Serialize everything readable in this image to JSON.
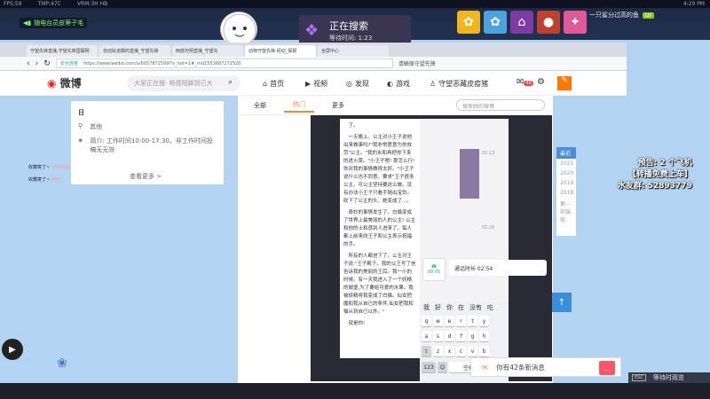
{
  "sysbar": [
    "FPS:59",
    "TMP:47C",
    "VRM:3H HB"
  ],
  "sysbar_time": "4:29 PM",
  "stream": {
    "connection": "随电台员皮蒂子毛",
    "search_title": "正在搜索",
    "wait_label": "等待时间: 1:23",
    "user_name": "一只鲨分过高的鱼",
    "user_level": "LV"
  },
  "browser": {
    "tabs": [
      "守望先锋直播,守望先锋国服网",
      "自动轨道脚的直播_守望先锋",
      "西部光明直播_守望先",
      "动物守望先锋-经动_探报",
      "全屏中心"
    ],
    "url": "https://www.weibo.com/u/6057872599?is_hot=1#_rnd1553687272520",
    "security_label": "安全连接",
    "extension_label": "请确保守望先锋"
  },
  "weibo": {
    "logo": "微博",
    "search_placeholder": "大家正在搜: 杨德阳脚到已大",
    "nav": [
      "首页",
      "视频",
      "发现",
      "游戏",
      "守望恶藏皮疫猪"
    ],
    "mail_badge": "40"
  },
  "card": {
    "title": "日",
    "other": "其他",
    "hours": "简介: 工作时间10:00-17:30。非工作时间投稿无无效",
    "more": "查看更多 >"
  },
  "feed": {
    "tabs": [
      "全部",
      "热门",
      "更多"
    ],
    "search_placeholder": "搜索她的微博",
    "novel_paragraphs": [
      "了。",
      "一天晚上。公主对小王子说他出来做事吗?\"我非常愿意为你效劳\"公主。\"我的永和再把你下来的进火菜。\"小王子嗯! 那怎么行! 你对我的事情做得太好。\"小王子说什么也不同意。要求\"王子很多公主。可公主坚持要这么做。没有办法小王子只看手随出宝剑。砍下了公主的头、她变成了...。",
      "奇妙的事情发生了。白猫变成了世界上最美丽的人的公主! 公主和他的士和感到人进来了。每人都上前来向王子和公主表示祝福的手。",
      "所有的人都进下了。公主对王子说:\"王子殿下。我的父王写了信告诉我的美丽的王后。我一小的时候。有一天我进入了一个妖精的城堡,为了要给可爱的水果。我被妖精将我变成了白猫。仙女把魔和我从自已的条件,仙女把我和猫从到自已以外。\"",
      "就是你!"
    ],
    "chat_time_1": "02:13",
    "chat_time_2": "02:26",
    "call_status": "通话时长 02:54",
    "call_icon_time": "08:05",
    "kbd_candidates": [
      "我",
      "好",
      "你",
      "在",
      "没有",
      "吃"
    ],
    "kbd_rows": [
      [
        "q",
        "w",
        "e",
        "r",
        "t",
        "y"
      ],
      [
        "a",
        "s",
        "d",
        "f",
        "g",
        "h"
      ],
      [
        "z",
        "x",
        "c",
        "v",
        "b",
        "n"
      ]
    ],
    "kbd_num": "123",
    "kbd_space": "空格"
  },
  "years": [
    "最近",
    "2021",
    "2020",
    "2019",
    "2018",
    "更—前端局"
  ],
  "danmu": [
    {
      "label": "收藏寄了~",
      "user": "下次欢迎"
    },
    {
      "label": "收藏寄了~",
      "user": "你好"
    }
  ],
  "msgbar": {
    "text": "你有42条新消息"
  },
  "overlay": {
    "lines": [
      "预告: 2 个飞机",
      "【转播免费上车】",
      "水友群: 52893779"
    ]
  },
  "esc": {
    "key": "ESC",
    "label": "等待时观览"
  },
  "colors": {
    "accent": "#e84a2e",
    "weibo_blue": "#4a8fd8",
    "page_bg": "#b3d4f0"
  }
}
